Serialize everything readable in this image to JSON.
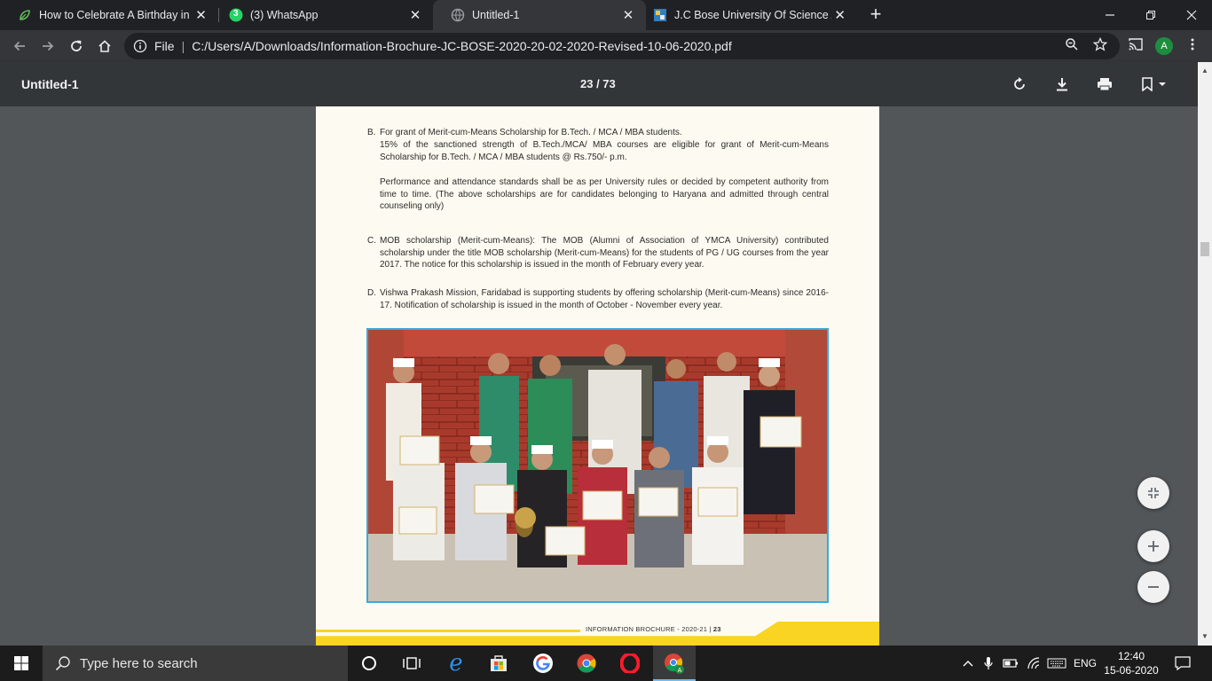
{
  "browser": {
    "tabs": [
      {
        "title": "How to Celebrate A Birthday in C",
        "favicon": "leaf-icon",
        "active": false
      },
      {
        "title": "(3) WhatsApp",
        "favicon": "whatsapp-icon",
        "badge": "3",
        "active": false
      },
      {
        "title": "Untitled-1",
        "favicon": "globe-icon",
        "active": true
      },
      {
        "title": "J.C Bose University Of Science Ar",
        "favicon": "university-icon",
        "active": false
      }
    ],
    "address": {
      "scheme_label": "File",
      "url": "C:/Users/A/Downloads/Information-Brochure-JC-BOSE-2020-20-02-2020-Revised-10-06-2020.pdf"
    },
    "profile_initial": "A"
  },
  "pdf_toolbar": {
    "title": "Untitled-1",
    "page_indicator": "23 / 73"
  },
  "document": {
    "paragraphs": [
      {
        "letter": "B.",
        "text": "For grant of Merit-cum-Means Scholarship for B.Tech. / MCA / MBA students."
      },
      {
        "letter": "",
        "text": "15% of the sanctioned strength of B.Tech./MCA/ MBA courses are eligible for grant of Merit-cum-Means Scholarship for B.Tech. / MCA / MBA students @ Rs.750/- p.m."
      },
      {
        "letter": "",
        "text": "Performance and attendance standards shall be as per University rules or decided by competent authority from time to time. (The above scholarships are for candidates belonging to Haryana and admitted through central counseling only)"
      },
      {
        "letter": "C.",
        "text": "MOB scholarship (Merit-cum-Means): The MOB (Alumni of Association of YMCA University) contributed scholarship under the title MOB scholarship (Merit-cum-Means) for the students of PG / UG courses from the year 2017. The notice for this scholarship is issued in the month of February every year."
      },
      {
        "letter": "D.",
        "text": "Vishwa Prakash Mission, Faridabad is supporting students by offering scholarship (Merit-cum-Means) since 2016-17. Notification of scholarship is issued in the month of October - November every year."
      }
    ],
    "footer_label": "INFORMATION BROCHURE - 2020-21 |",
    "footer_page": "23"
  },
  "taskbar": {
    "search_placeholder": "Type here to search",
    "language": "ENG",
    "time": "12:40",
    "date": "15-06-2020"
  },
  "colors": {
    "accent_blue": "#39a9db",
    "footer_yellow": "#f9d423",
    "page_bg": "#fdfbf1"
  }
}
